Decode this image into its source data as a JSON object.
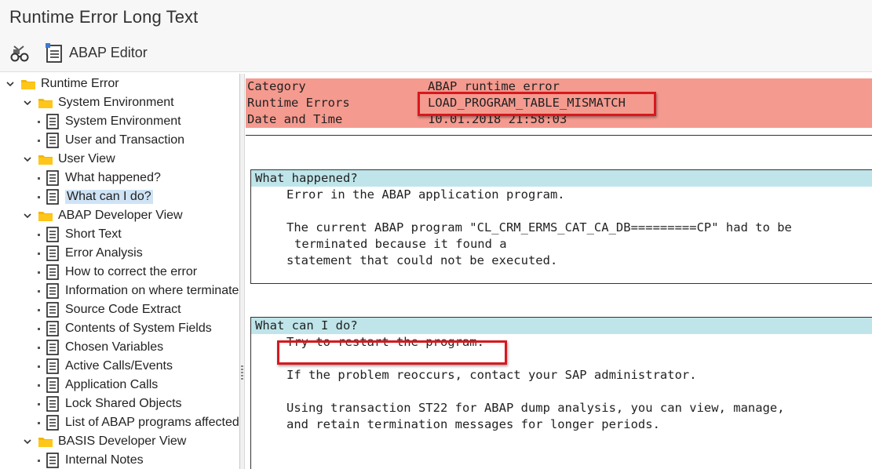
{
  "window": {
    "title": "Runtime Error Long Text"
  },
  "toolbar": {
    "abap_editor_label": "ABAP Editor"
  },
  "tree": [
    {
      "label": "Runtime Error",
      "type": "folder",
      "level": 0,
      "expanded": true
    },
    {
      "label": "System Environment",
      "type": "folder",
      "level": 1,
      "expanded": true
    },
    {
      "label": "System Environment",
      "type": "doc",
      "level": 2
    },
    {
      "label": "User and Transaction",
      "type": "doc",
      "level": 2
    },
    {
      "label": "User View",
      "type": "folder",
      "level": 1,
      "expanded": true
    },
    {
      "label": "What happened?",
      "type": "doc",
      "level": 2
    },
    {
      "label": "What can I do?",
      "type": "doc",
      "level": 2,
      "selected": true
    },
    {
      "label": "ABAP Developer View",
      "type": "folder",
      "level": 1,
      "expanded": true
    },
    {
      "label": "Short Text",
      "type": "doc",
      "level": 2
    },
    {
      "label": "Error Analysis",
      "type": "doc",
      "level": 2
    },
    {
      "label": "How to correct the error",
      "type": "doc",
      "level": 2
    },
    {
      "label": "Information on where terminated",
      "type": "doc",
      "level": 2
    },
    {
      "label": "Source Code Extract",
      "type": "doc",
      "level": 2
    },
    {
      "label": "Contents of System Fields",
      "type": "doc",
      "level": 2
    },
    {
      "label": "Chosen Variables",
      "type": "doc",
      "level": 2
    },
    {
      "label": "Active Calls/Events",
      "type": "doc",
      "level": 2
    },
    {
      "label": "Application Calls",
      "type": "doc",
      "level": 2
    },
    {
      "label": "Lock Shared Objects",
      "type": "doc",
      "level": 2
    },
    {
      "label": "List of ABAP programs affected",
      "type": "doc",
      "level": 2
    },
    {
      "label": "BASIS Developer View",
      "type": "folder",
      "level": 1,
      "expanded": true
    },
    {
      "label": "Internal Notes",
      "type": "doc",
      "level": 2
    }
  ],
  "header": {
    "category_key": "Category",
    "category_value": "ABAP runtime error",
    "runtime_errors_key": "Runtime Errors",
    "runtime_errors_value": "LOAD_PROGRAM_TABLE_MISMATCH",
    "date_key": "Date and Time",
    "date_value": "10.01.2018 21:58:03"
  },
  "what_happened": {
    "heading": "What happened?",
    "line1": "Error in the ABAP application program.",
    "line2": "The current ABAP program \"CL_CRM_ERMS_CAT_CA_DB=========CP\" had to be",
    "line3": "terminated because it found a",
    "line4": "statement that could not be executed."
  },
  "what_can_i_do": {
    "heading": "What can I do?",
    "line1": "Try to restart the program.",
    "line2": "If the problem reoccurs, contact your SAP administrator.",
    "line3": "Using transaction ST22 for ABAP dump analysis, you can view, manage,",
    "line4": "and retain termination messages for longer periods."
  },
  "icons": {
    "toolbar_first": "glasses-icon",
    "toolbar_second": "editor-icon",
    "folder": "folder-icon",
    "doc": "document-icon"
  },
  "colors": {
    "header_bg": "#f59a8f",
    "section_head_bg": "#bfe5ea",
    "highlight_border": "#d7181e",
    "selection_bg": "#cfe3f5",
    "folder": "#f2b705"
  }
}
